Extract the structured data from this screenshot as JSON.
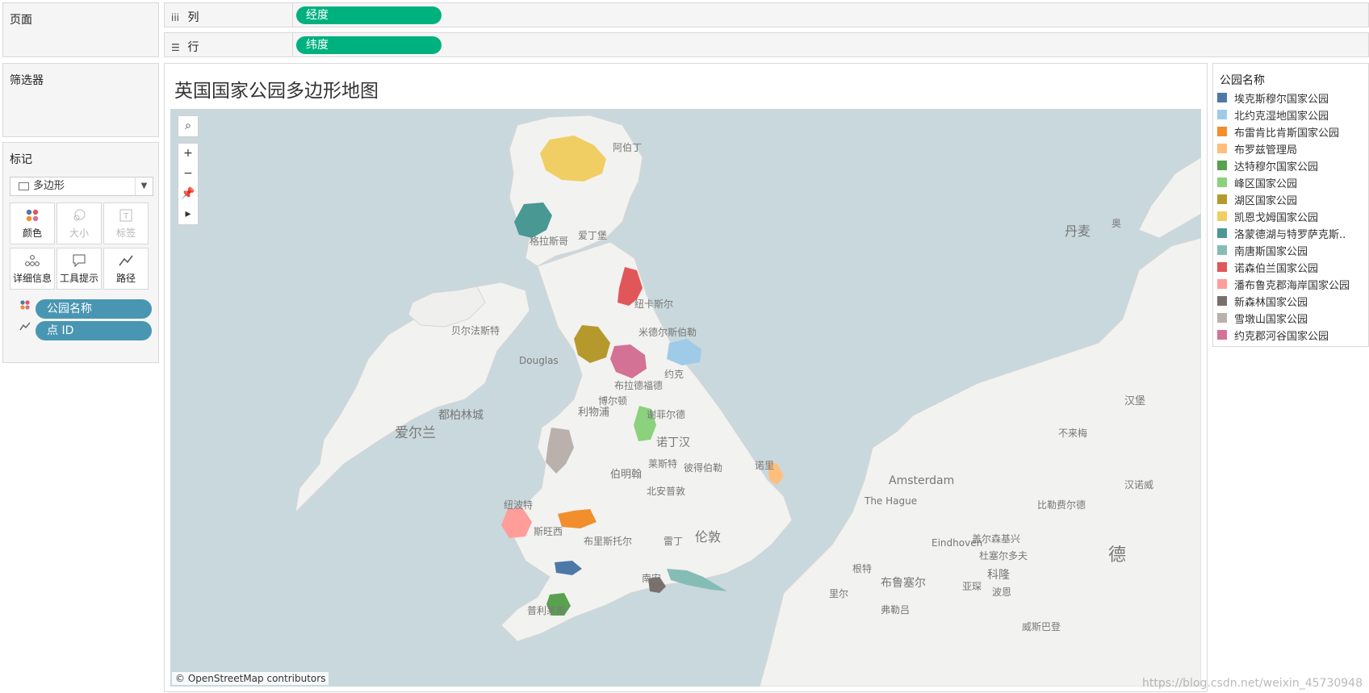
{
  "pages": {
    "title": "页面"
  },
  "filters": {
    "title": "筛选器"
  },
  "marks": {
    "title": "标记",
    "mark_type": "多边形",
    "buttons": [
      {
        "label": "颜色",
        "icon": "color-dots-icon",
        "enabled": true
      },
      {
        "label": "大小",
        "icon": "size-icon",
        "enabled": false
      },
      {
        "label": "标签",
        "icon": "label-icon",
        "enabled": false
      },
      {
        "label": "详细信息",
        "icon": "detail-icon",
        "enabled": true
      },
      {
        "label": "工具提示",
        "icon": "tooltip-icon",
        "enabled": true
      },
      {
        "label": "路径",
        "icon": "path-icon",
        "enabled": true
      }
    ],
    "fields": [
      {
        "label": "公园名称",
        "icon": "color-dots-icon"
      },
      {
        "label": "点 ID",
        "icon": "path-icon"
      }
    ]
  },
  "shelves": {
    "columns": {
      "label": "列",
      "pill": "经度"
    },
    "rows": {
      "label": "行",
      "pill": "纬度"
    }
  },
  "viz": {
    "title": "英国国家公园多边形地图",
    "attribution": "© OpenStreetMap contributors"
  },
  "map_labels": [
    {
      "text": "阿伯丁",
      "size": 12
    },
    {
      "text": "格拉斯哥",
      "size": 12
    },
    {
      "text": "爱丁堡",
      "size": 12
    },
    {
      "text": "纽卡斯尔",
      "size": 12
    },
    {
      "text": "贝尔法斯特",
      "size": 12
    },
    {
      "text": "米德尔斯伯勒",
      "size": 12
    },
    {
      "text": "Douglas",
      "size": 12
    },
    {
      "text": "约克",
      "size": 12
    },
    {
      "text": "布拉德福德",
      "size": 12
    },
    {
      "text": "博尔顿",
      "size": 12
    },
    {
      "text": "利物浦",
      "size": 13
    },
    {
      "text": "谢菲尔德",
      "size": 12
    },
    {
      "text": "都柏林城",
      "size": 14
    },
    {
      "text": "爱尔兰",
      "size": 17
    },
    {
      "text": "诺丁汉",
      "size": 14
    },
    {
      "text": "莱斯特",
      "size": 12
    },
    {
      "text": "彼得伯勒",
      "size": 12
    },
    {
      "text": "诺里",
      "size": 12
    },
    {
      "text": "伯明翰",
      "size": 13
    },
    {
      "text": "北安普敦",
      "size": 12
    },
    {
      "text": "纽波特",
      "size": 12
    },
    {
      "text": "斯旺西",
      "size": 12
    },
    {
      "text": "布里斯托尔",
      "size": 12
    },
    {
      "text": "雷丁",
      "size": 12
    },
    {
      "text": "伦敦",
      "size": 16
    },
    {
      "text": "普利茅斯",
      "size": 12
    },
    {
      "text": "南安",
      "size": 12
    },
    {
      "text": "丹麦",
      "size": 16
    },
    {
      "text": "Amsterdam",
      "size": 14
    },
    {
      "text": "The Hague",
      "size": 12
    },
    {
      "text": "汉堡",
      "size": 13
    },
    {
      "text": "不来梅",
      "size": 12
    },
    {
      "text": "汉诺威",
      "size": 12
    },
    {
      "text": "比勒费尔德",
      "size": 12
    },
    {
      "text": "Eindhoven",
      "size": 12
    },
    {
      "text": "盖尔森基兴",
      "size": 12
    },
    {
      "text": "杜塞尔多夫",
      "size": 12
    },
    {
      "text": "根特",
      "size": 12
    },
    {
      "text": "布鲁塞尔",
      "size": 14
    },
    {
      "text": "里尔",
      "size": 12
    },
    {
      "text": "亚琛",
      "size": 12
    },
    {
      "text": "科隆",
      "size": 14
    },
    {
      "text": "波恩",
      "size": 12
    },
    {
      "text": "弗勒吕",
      "size": 12
    },
    {
      "text": "德",
      "size": 22
    },
    {
      "text": "威斯巴登",
      "size": 12
    },
    {
      "text": "奥",
      "size": 12
    }
  ],
  "legend": {
    "title": "公园名称",
    "items": [
      {
        "label": "埃克斯穆尔国家公园",
        "color": "#4e79a7"
      },
      {
        "label": "北约克湿地国家公园",
        "color": "#a0cbe8"
      },
      {
        "label": "布雷肯比肯斯国家公园",
        "color": "#f28e2b"
      },
      {
        "label": "布罗兹管理局",
        "color": "#ffbe7d"
      },
      {
        "label": "达特穆尔国家公园",
        "color": "#59a14f"
      },
      {
        "label": "峰区国家公园",
        "color": "#8cd17d"
      },
      {
        "label": "湖区国家公园",
        "color": "#b6992d"
      },
      {
        "label": "凯恩戈姆国家公园",
        "color": "#f1ce63"
      },
      {
        "label": "洛蒙德湖与特罗萨克斯..",
        "color": "#499894"
      },
      {
        "label": "南唐斯国家公园",
        "color": "#86bcb6"
      },
      {
        "label": "诺森伯兰国家公园",
        "color": "#e15759"
      },
      {
        "label": "潘布鲁克郡海岸国家公园",
        "color": "#ff9d9a"
      },
      {
        "label": "新森林国家公园",
        "color": "#79706e"
      },
      {
        "label": "雪墩山国家公园",
        "color": "#bab0ac"
      },
      {
        "label": "约克郡河谷国家公园",
        "color": "#d37295"
      }
    ]
  },
  "watermark": "https://blog.csdn.net/weixin_45730948"
}
